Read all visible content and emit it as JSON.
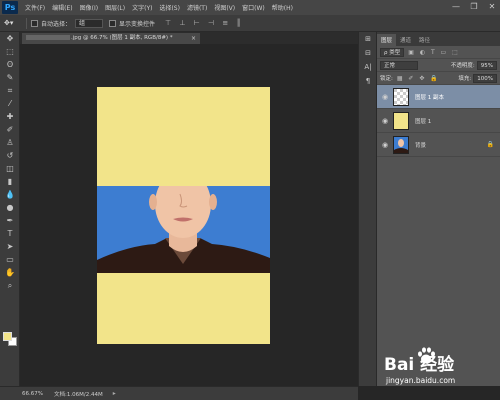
{
  "app": {
    "logo": "Ps"
  },
  "menu": [
    "文件(F)",
    "编辑(E)",
    "图像(I)",
    "图层(L)",
    "文字(Y)",
    "选择(S)",
    "滤镜(T)",
    "视图(V)",
    "窗口(W)",
    "帮助(H)"
  ],
  "window_controls": {
    "minimize": "—",
    "restore": "❐",
    "close": "✕"
  },
  "options": {
    "auto_select_label": "自动选择：",
    "auto_select_value": "组",
    "show_transform_label": "显示变换控件"
  },
  "document_tab": {
    "title": ".jpg @ 66.7% (图层 1 副本, RGB/8#) *",
    "close": "×"
  },
  "status": {
    "zoom": "66.67%",
    "doc_info": "文档:1.06M/2.44M",
    "arrow": "▸"
  },
  "panels": {
    "tabs": [
      "图层",
      "通道",
      "路径"
    ],
    "kind_label": "ρ 类型",
    "blend_mode": "正常",
    "opacity_label": "不透明度:",
    "opacity_value": "95%",
    "lock_label": "锁定:",
    "fill_label": "填充:",
    "fill_value": "100%"
  },
  "layers": [
    {
      "name": "图层 1 副本",
      "selected": true,
      "thumb": "checker"
    },
    {
      "name": "图层 1",
      "selected": false,
      "thumb": "yellow"
    },
    {
      "name": "背景",
      "selected": false,
      "thumb": "portrait",
      "locked": true
    }
  ],
  "watermark": {
    "text": "Bai  经验",
    "url": "jingyan.baidu.com"
  },
  "colors": {
    "foreground": "#f1e389",
    "background": "#ffffff",
    "canvas_fill": "#f2e48a",
    "photo_bg": "#3d7dd1",
    "selection": "#7c8ea6"
  }
}
